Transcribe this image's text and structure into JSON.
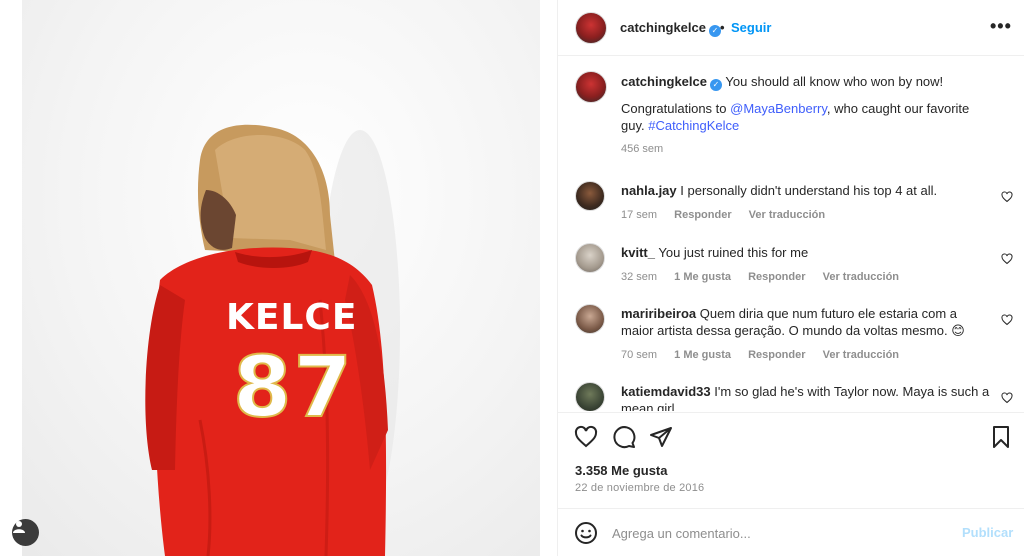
{
  "post": {
    "author": "catchingkelce",
    "follow_label": "Seguir",
    "separator": "•",
    "more_label": "•••",
    "jersey_name": "KELCE",
    "jersey_number": "87"
  },
  "caption": {
    "author": "catchingkelce",
    "line1": "You should all know who won by now!",
    "line2_prefix": "Congratulations to ",
    "mention": "@MayaBenberry",
    "line2_suffix": ", who caught our favorite guy. ",
    "hashtag": "#CatchingKelce",
    "time": "456 sem"
  },
  "comments": [
    {
      "user": "nahla.jay",
      "text": "I personally didn't understand his top 4 at all.",
      "time": "17 sem",
      "likes": "",
      "reply": "Responder",
      "translate": "Ver traducción",
      "icon": "heart-outline-icon"
    },
    {
      "user": "kvitt_",
      "text": "You just ruined this for me",
      "time": "32 sem",
      "likes": "1 Me gusta",
      "reply": "Responder",
      "translate": "Ver traducción",
      "icon": "heart-outline-icon"
    },
    {
      "user": "mariribeiroa",
      "text": "Quem diria que num futuro ele estaria com a maior artista dessa geração. O mundo da voltas mesmo. 😊",
      "time": "70 sem",
      "likes": "1 Me gusta",
      "reply": "Responder",
      "translate": "Ver traducción",
      "icon": "heart-outline-icon"
    },
    {
      "user": "katiemdavid33",
      "text": "I'm so glad he's with Taylor now. Maya is such a mean girl",
      "time": "",
      "likes": "",
      "reply": "",
      "translate": "",
      "icon": "heart-outline-icon"
    }
  ],
  "actions": {
    "likes_count": "3.358 Me gusta",
    "date": "22 de noviembre de 2016",
    "icons": [
      "heart-outline-icon",
      "comment-icon",
      "share-icon",
      "bookmark-icon"
    ]
  },
  "composer": {
    "placeholder": "Agrega un comentario...",
    "publish_label": "Publicar"
  },
  "colors": {
    "accent": "#0095f6",
    "link": "#3f5efb",
    "jersey": "#e2231a",
    "muted": "#8e8e8e"
  }
}
